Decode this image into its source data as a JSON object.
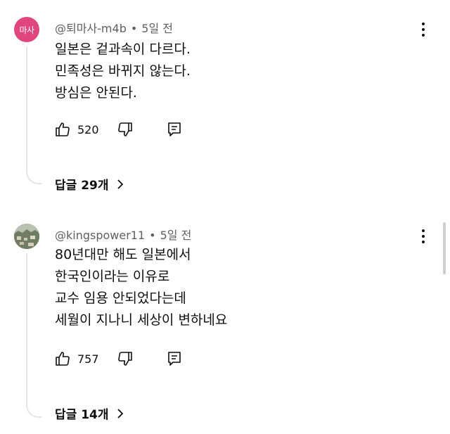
{
  "comments": [
    {
      "avatar_text": "마사",
      "avatar_color": "#e0457b",
      "author": "@퇴마사-m4b",
      "time": "5일 전",
      "lines": [
        "일본은 겉과속이 다르다.",
        "민족성은 바뀌지 않는다.",
        "방심은 안된다."
      ],
      "likes": "520",
      "replies_label": "답글 29개"
    },
    {
      "avatar_text": "",
      "avatar_color": "#7d8a6e",
      "author": "@kingspower11",
      "time": "5일 전",
      "lines": [
        "80년대만 해도 일본에서",
        "한국인이라는 이유로",
        "교수 임용 안되었다는데",
        "세월이 지나니 세상이 변하네요"
      ],
      "likes": "757",
      "replies_label": "답글 14개"
    }
  ],
  "separator": "•",
  "icons": {
    "like": "thumb-up-icon",
    "dislike": "thumb-down-icon",
    "reply": "comment-icon",
    "more": "more-vert-icon",
    "chevron": "chevron-right-icon"
  }
}
